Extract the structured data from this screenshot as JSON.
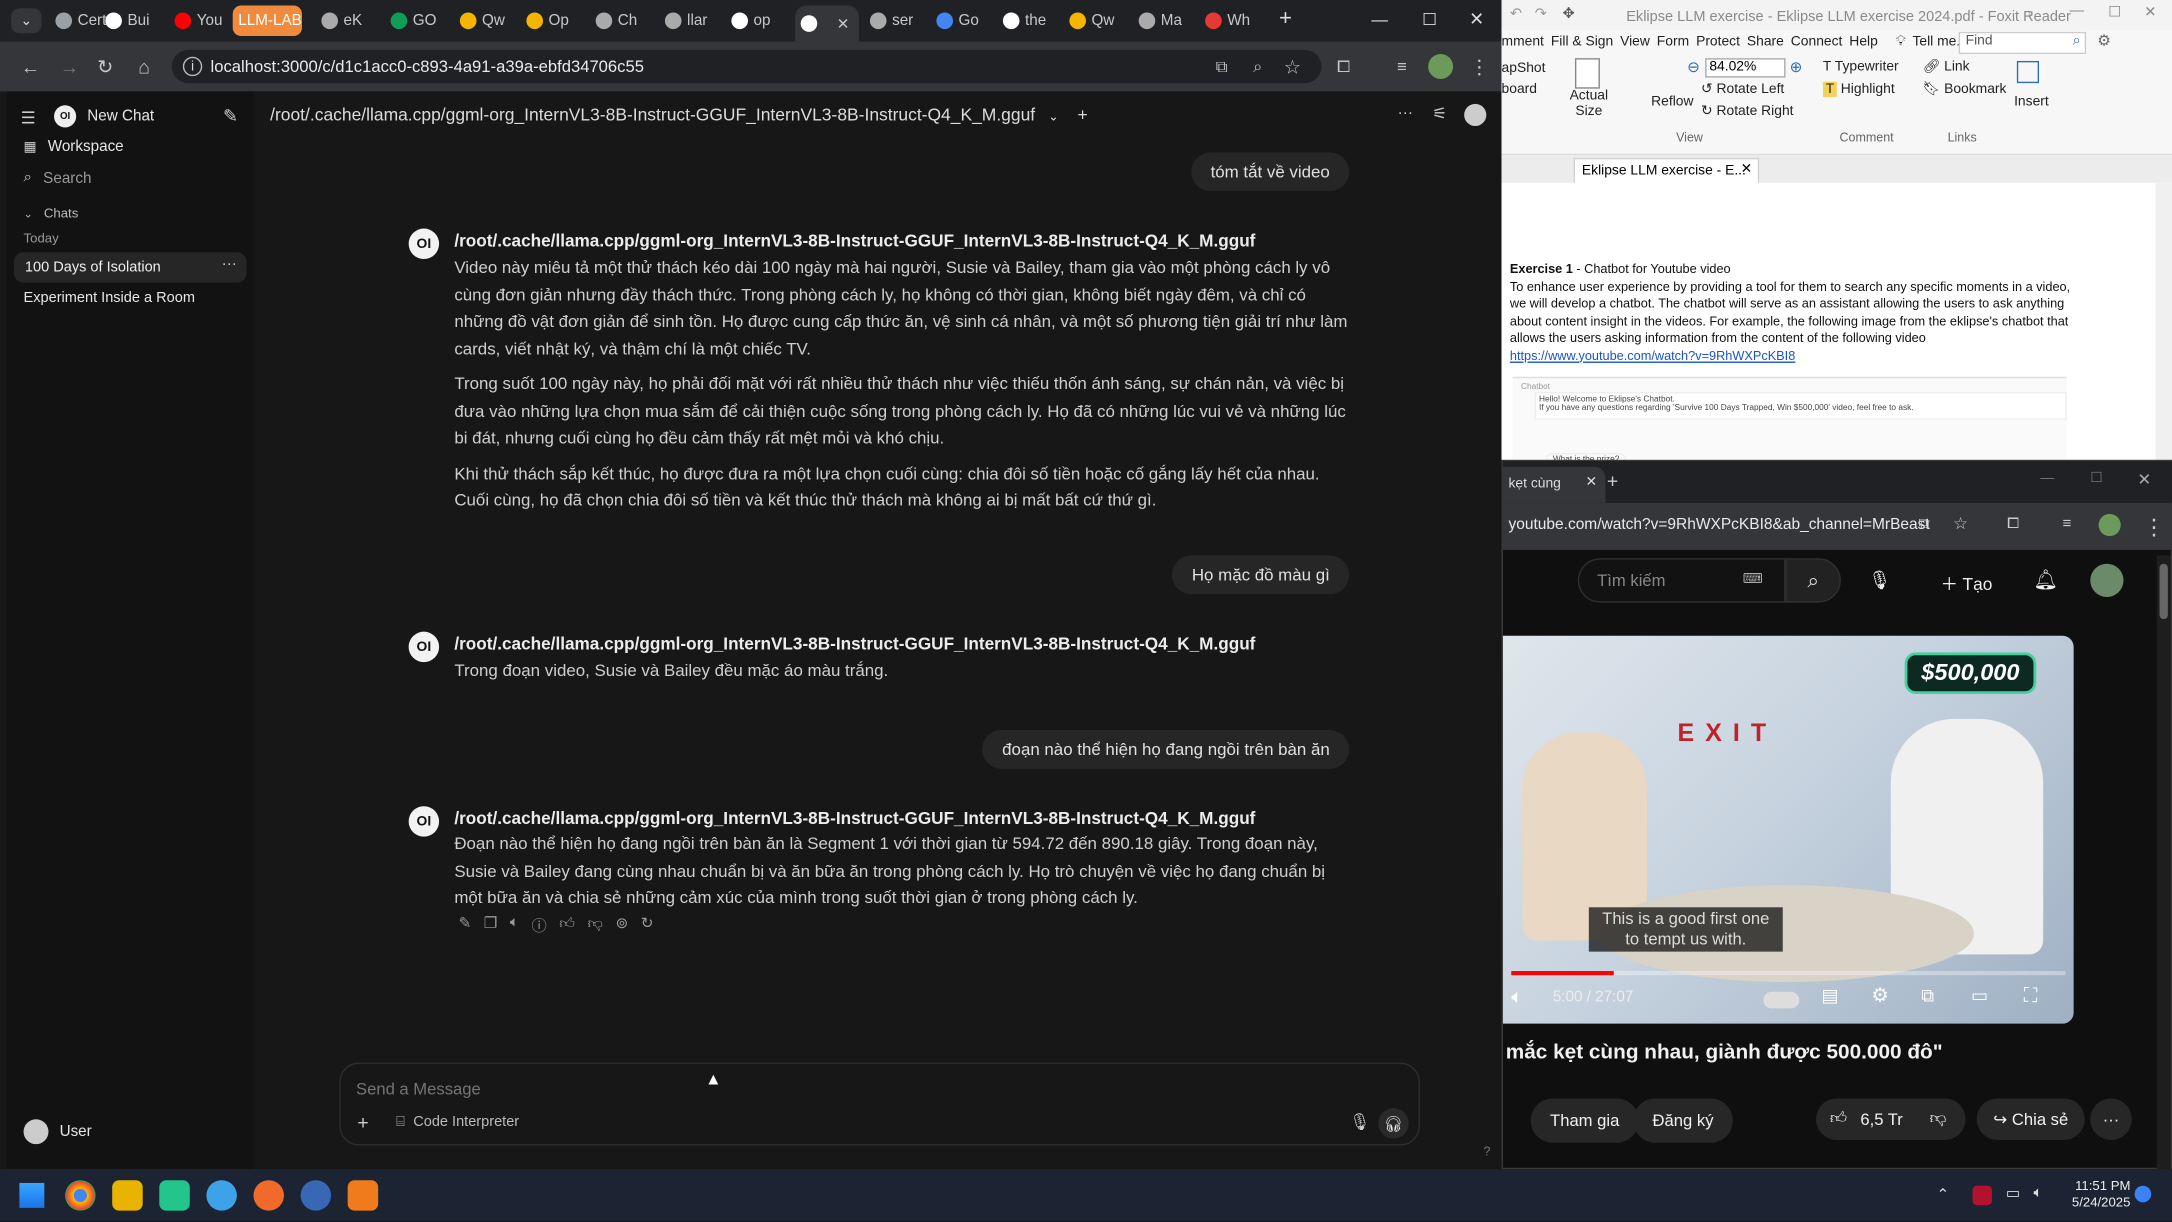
{
  "chrome": {
    "tabs": [
      {
        "label": "Cert",
        "color": "#9aa0a6"
      },
      {
        "label": "Bui",
        "color": "#ffffff"
      },
      {
        "label": "You",
        "color": "#ff0000"
      },
      {
        "label": "LLM-LAB",
        "color": "#f08a3c"
      },
      {
        "label": "eK",
        "color": "#aaaaaa"
      },
      {
        "label": "GO",
        "color": "#0f9d58"
      },
      {
        "label": "Qw",
        "color": "#f4b400"
      },
      {
        "label": "Op",
        "color": "#f4b400"
      },
      {
        "label": "Ch",
        "color": "#aaaaaa"
      },
      {
        "label": "llar",
        "color": "#aaaaaa"
      },
      {
        "label": "op",
        "color": "#ffffff"
      },
      {
        "label": "",
        "color": "#ffffff"
      },
      {
        "label": "ser",
        "color": "#aaaaaa"
      },
      {
        "label": "Go",
        "color": "#4285f4"
      },
      {
        "label": "the",
        "color": "#ffffff"
      },
      {
        "label": "Qw",
        "color": "#f4b400"
      },
      {
        "label": "Ma",
        "color": "#aaaaaa"
      },
      {
        "label": "Wh",
        "color": "#e53935"
      }
    ],
    "url": "localhost:3000/c/d1c1acc0-c893-4a91-a39a-ebfd34706c55"
  },
  "sidebar": {
    "new_chat": "New Chat",
    "workspace": "Workspace",
    "search": "Search",
    "chats_header": "Chats",
    "today": "Today",
    "items": [
      "100 Days of Isolation",
      "Experiment Inside a Room"
    ],
    "user": "User"
  },
  "header": {
    "model_path": "/root/.cache/llama.cpp/ggml-org_InternVL3-8B-Instruct-GGUF_InternVL3-8B-Instruct-Q4_K_M.gguf"
  },
  "messages": {
    "user1": "tóm tắt về video",
    "model_name": "/root/.cache/llama.cpp/ggml-org_InternVL3-8B-Instruct-GGUF_InternVL3-8B-Instruct-Q4_K_M.gguf",
    "a1_p1": "Video này miêu tả một thử thách kéo dài 100 ngày mà hai người, Susie và Bailey, tham gia vào một phòng cách ly vô cùng đơn giản nhưng đầy thách thức. Trong phòng cách ly, họ không có thời gian, không biết ngày đêm, và chỉ có những đồ vật đơn giản để sinh tồn. Họ được cung cấp thức ăn, vệ sinh cá nhân, và một số phương tiện giải trí như làm cards, viết nhật ký, và thậm chí là một chiếc TV.",
    "a1_p2": "Trong suốt 100 ngày này, họ phải đối mặt với rất nhiều thử thách như việc thiếu thốn ánh sáng, sự chán nản, và việc bị đưa vào những lựa chọn mua sắm để cải thiện cuộc sống trong phòng cách ly. Họ đã có những lúc vui vẻ và những lúc bi đát, nhưng cuối cùng họ đều cảm thấy rất mệt mỏi và khó chịu.",
    "a1_p3": "Khi thử thách sắp kết thúc, họ được đưa ra một lựa chọn cuối cùng: chia đôi số tiền hoặc cố gắng lấy hết của nhau. Cuối cùng, họ đã chọn chia đôi số tiền và kết thúc thử thách mà không ai bị mất bất cứ thứ gì.",
    "user2": "Họ mặc đồ màu gì",
    "a2": "Trong đoạn video, Susie và Bailey đều mặc áo màu trắng.",
    "user3": "đoạn nào thể hiện họ đang ngồi trên bàn ăn",
    "a3": "Đoạn nào thể hiện họ đang ngồi trên bàn ăn là Segment 1 với thời gian từ 594.72 đến 890.18 giây. Trong đoạn này, Susie và Bailey đang cùng nhau chuẩn bị và ăn bữa ăn trong phòng cách ly. Họ trò chuyện về việc họ đang chuẩn bị một bữa ăn và chia sẻ những cảm xúc của mình trong suốt thời gian ở trong phòng cách ly."
  },
  "input": {
    "placeholder": "Send a Message",
    "code_interpreter": "Code Interpreter"
  },
  "foxit": {
    "title": "Eklipse LLM exercise - Eklipse LLM exercise 2024.pdf - Foxit Reader",
    "find": "Find",
    "menu": [
      "mment",
      "Fill & Sign",
      "View",
      "Form",
      "Protect",
      "Share",
      "Connect",
      "Help",
      "Tell me..."
    ],
    "zoom": "84.02%",
    "tools": {
      "snapshot": "apShot",
      "clipboard": "board",
      "actual_size": "Actual Size",
      "reflow": "Reflow",
      "rotate_left": "Rotate Left",
      "rotate_right": "Rotate Right",
      "typewriter": "Typewriter",
      "highlight": "Highlight",
      "link": "Link",
      "bookmark": "Bookmark",
      "insert": "Insert"
    },
    "groups": {
      "view": "View",
      "comment": "Comment",
      "links": "Links"
    },
    "doc_tab": "Eklipse LLM exercise - E...",
    "exercise_title": "Exercise 1",
    "exercise_sub": " - Chatbot for Youtube video",
    "exercise_body": "To enhance user experience by providing a tool for them to search any specific moments in a video, we will develop a chatbot. The chatbot will serve as an assistant allowing the users to ask anything about content insight in the videos. For example, the following image from the eklipse's chatbot that allows the users asking information from the content of the following video",
    "link": "https://www.youtube.com/watch?v=9RhWXPcKBI8",
    "chatbot_label": "Chatbot",
    "chatbot_hello": "Hello! Welcome to Eklipse's Chatbot.",
    "chatbot_q": "If you have any questions regarding 'Survive 100 Days Trapped, Win $500,000' video, feel free to ask.",
    "chatbot_prize": "What is the prize?"
  },
  "youtube": {
    "tab": "kẹt cùng",
    "url": "youtube.com/watch?v=9RhWXPcKBI8&ab_channel=MrBeast",
    "search_placeholder": "Tìm kiếm",
    "create": "Tạo",
    "badge": "$500,000",
    "exit_sign": "EXIT",
    "subtitle": "This is a good first one to tempt us with.",
    "time": "5:00 / 27:07",
    "progress": 0.185,
    "title": "mắc kẹt cùng nhau, giành được 500.000 đô\"",
    "join": "Tham gia",
    "subscribe": "Đăng ký",
    "likes": "6,5 Tr",
    "share": "Chia sẻ"
  },
  "taskbar": {
    "time": "11:51 PM",
    "date": "5/24/2025"
  }
}
